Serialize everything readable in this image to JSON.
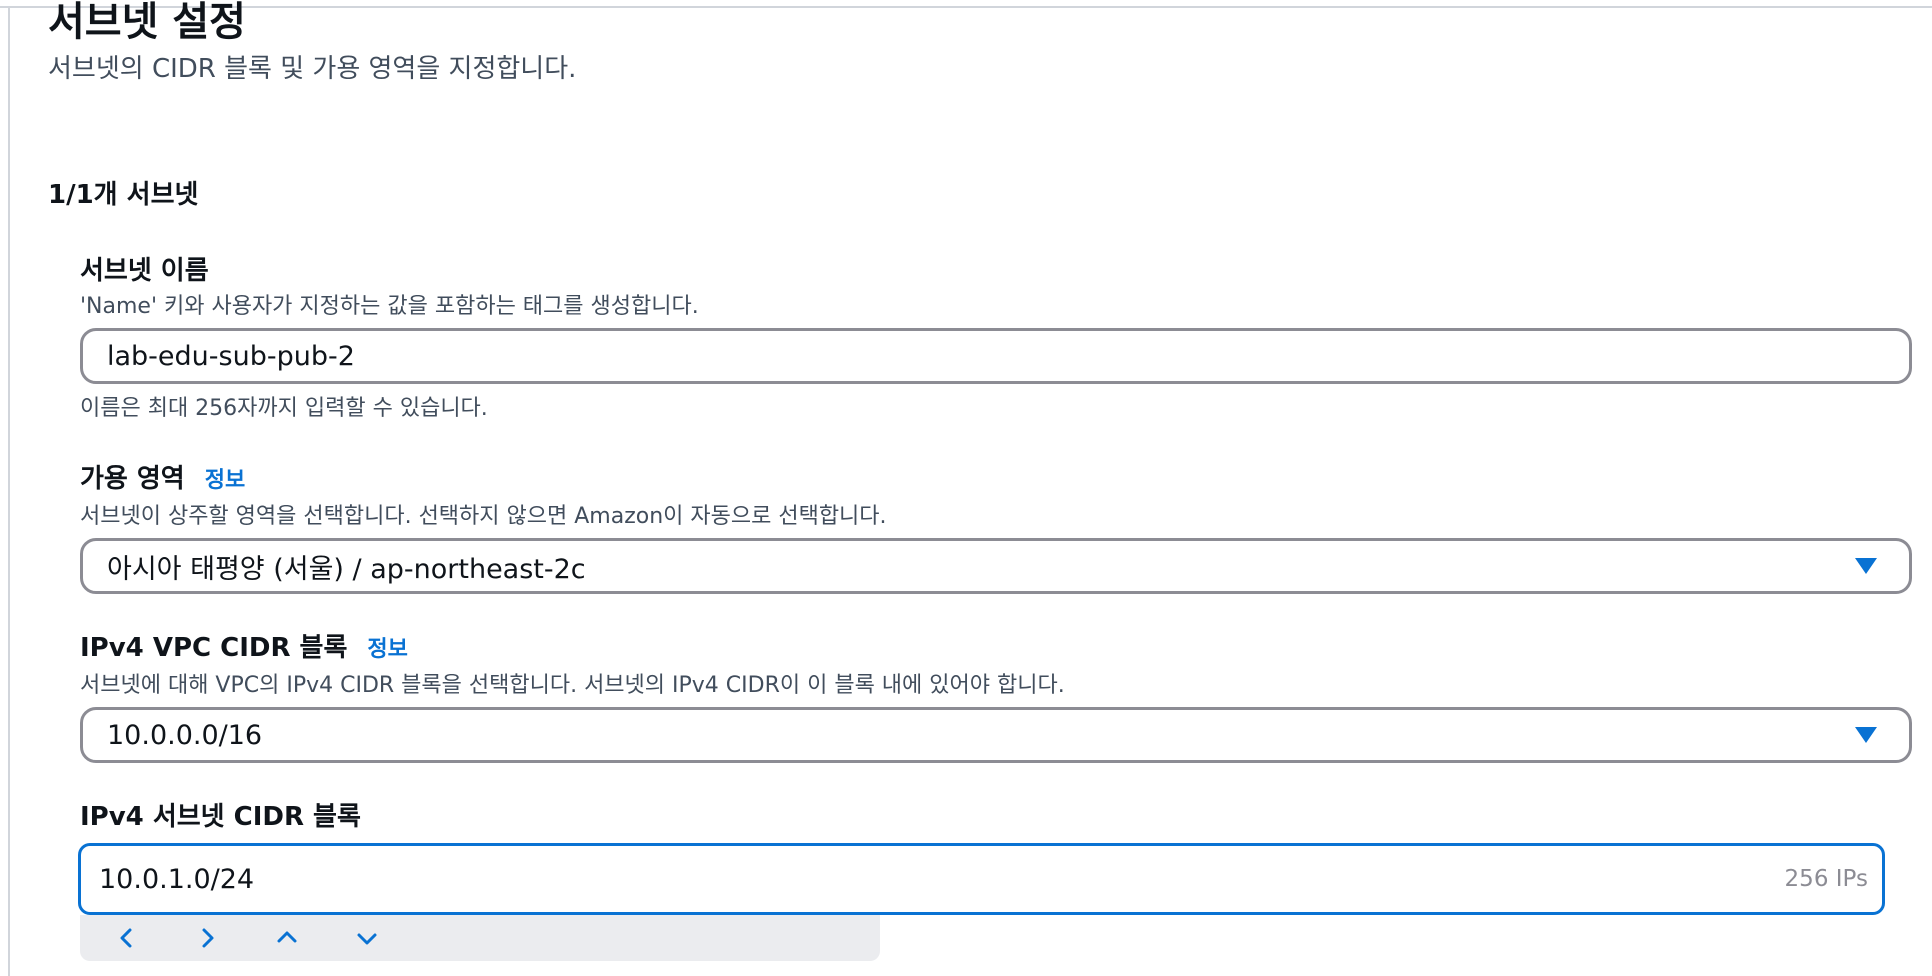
{
  "header": {
    "title": "서브넷 설정",
    "description": "서브넷의 CIDR 블록 및 가용 영역을 지정합니다."
  },
  "subnet_count": "1/1개 서브넷",
  "subnet_name": {
    "label": "서브넷 이름",
    "description": "'Name' 키와 사용자가 지정하는 값을 포함하는 태그를 생성합니다.",
    "value": "lab-edu-sub-pub-2",
    "hint": "이름은 최대 256자까지 입력할 수 있습니다."
  },
  "availability_zone": {
    "label": "가용 영역",
    "info_link": "정보",
    "description": "서브넷이 상주할 영역을 선택합니다. 선택하지 않으면 Amazon이 자동으로 선택합니다.",
    "selected": "아시아 태평양 (서울) / ap-northeast-2c"
  },
  "vpc_cidr": {
    "label": "IPv4 VPC CIDR 블록",
    "info_link": "정보",
    "description": "서브넷에 대해 VPC의 IPv4 CIDR 블록을 선택합니다. 서브넷의 IPv4 CIDR이 이 블록 내에 있어야 합니다.",
    "selected": "10.0.0.0/16"
  },
  "subnet_cidr": {
    "label": "IPv4 서브넷 CIDR 블록",
    "value": "10.0.1.0/24",
    "ip_count": "256 IPs"
  },
  "colors": {
    "accent": "#0972d3",
    "border": "#8c8c94",
    "stepper_bg": "#ebecef"
  }
}
